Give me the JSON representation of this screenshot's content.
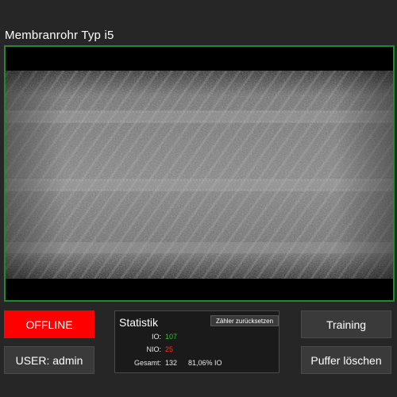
{
  "header": {
    "title": "Membranrohr Typ i5"
  },
  "image_view": {
    "border_color": "#1f8c2b"
  },
  "buttons": {
    "offline": "OFFLINE",
    "user": "USER: admin",
    "training": "Training",
    "buffer": "Puffer löschen"
  },
  "stats": {
    "title": "Statistik",
    "reset_label": "Zähler zurücksetzen",
    "io_label": "IO:",
    "io_value": "107",
    "nio_label": "NIO:",
    "nio_value": "25",
    "total_label": "Gesamt:",
    "total_value": "132",
    "percent_text": "81,06% IO"
  },
  "colors": {
    "offline_bg": "#ff0000",
    "io_value": "#2fc42f",
    "nio_value": "#ff2b2b",
    "background": "#262626"
  }
}
